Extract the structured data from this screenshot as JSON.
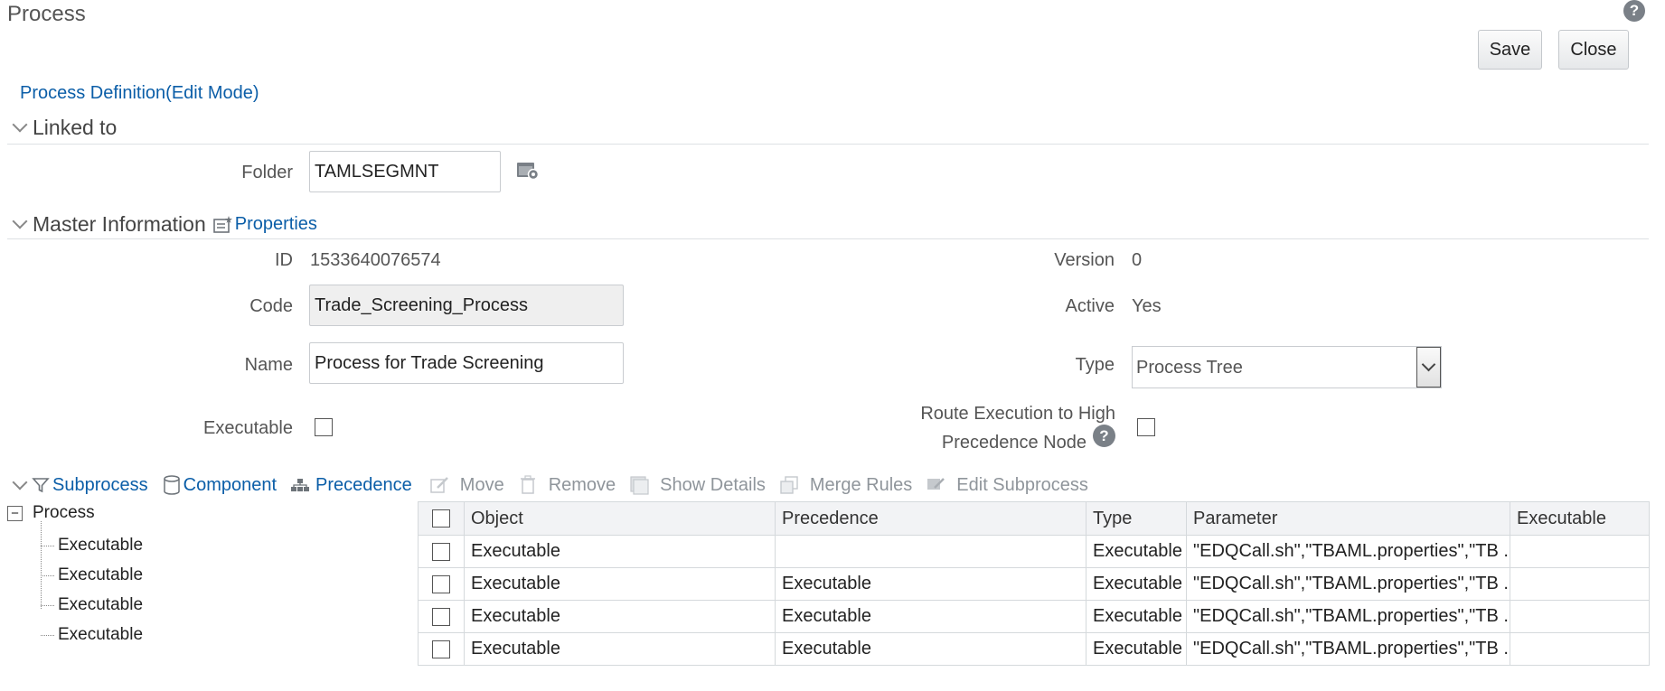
{
  "page": {
    "title": "Process",
    "help_icon": "help-icon"
  },
  "toolbar": {
    "save_label": "Save",
    "close_label": "Close"
  },
  "definition_link": "Process Definition(Edit Mode)",
  "linked_to": {
    "section_title": "Linked to",
    "folder_label": "Folder",
    "folder_value": "TAMLSEGMNT",
    "folder_browse_icon": "folder-browse-icon"
  },
  "master_info": {
    "section_title": "Master Information",
    "properties_link": "Properties",
    "id_label": "ID",
    "id_value": "1533640076574",
    "version_label": "Version",
    "version_value": "0",
    "code_label": "Code",
    "code_value": "Trade_Screening_Process",
    "active_label": "Active",
    "active_value": "Yes",
    "name_label": "Name",
    "name_value": "Process for Trade Screening",
    "type_label": "Type",
    "type_value": "Process Tree",
    "executable_label": "Executable",
    "executable_checked": false,
    "route_label_line1": "Route Execution to High",
    "route_label_line2": "Precedence Node",
    "route_checked": false
  },
  "subprocess_toolbar": {
    "items": [
      {
        "label": "Subprocess",
        "icon": "filter-icon",
        "enabled": true
      },
      {
        "label": "Component",
        "icon": "component-icon",
        "enabled": true
      },
      {
        "label": "Precedence",
        "icon": "precedence-icon",
        "enabled": true
      },
      {
        "label": "Move",
        "icon": "move-icon",
        "enabled": false
      },
      {
        "label": "Remove",
        "icon": "trash-icon",
        "enabled": false
      },
      {
        "label": "Show Details",
        "icon": "details-icon",
        "enabled": false
      },
      {
        "label": "Merge Rules",
        "icon": "merge-icon",
        "enabled": false
      },
      {
        "label": "Edit Subprocess",
        "icon": "edit-subprocess-icon",
        "enabled": false
      }
    ]
  },
  "tree": {
    "root": "Process",
    "children": [
      "Executable",
      "Executable",
      "Executable",
      "Executable"
    ]
  },
  "grid": {
    "columns": [
      "Object",
      "Precedence",
      "Type",
      "Parameter",
      "Executable"
    ],
    "rows": [
      {
        "object": "Executable",
        "precedence": "",
        "type": "Executable",
        "parameter": "\"EDQCall.sh\",\"TBAML.properties\",\"TB ...",
        "executable": ""
      },
      {
        "object": "Executable",
        "precedence": "Executable",
        "type": "Executable",
        "parameter": "\"EDQCall.sh\",\"TBAML.properties\",\"TB ...",
        "executable": ""
      },
      {
        "object": "Executable",
        "precedence": "Executable",
        "type": "Executable",
        "parameter": "\"EDQCall.sh\",\"TBAML.properties\",\"TB ...",
        "executable": ""
      },
      {
        "object": "Executable",
        "precedence": "Executable",
        "type": "Executable",
        "parameter": "\"EDQCall.sh\",\"TBAML.properties\",\"TB ...",
        "executable": ""
      }
    ]
  },
  "colors": {
    "link": "#0b5ea8",
    "disabled": "#8f959b",
    "header_bg": "#f2f3f5"
  }
}
